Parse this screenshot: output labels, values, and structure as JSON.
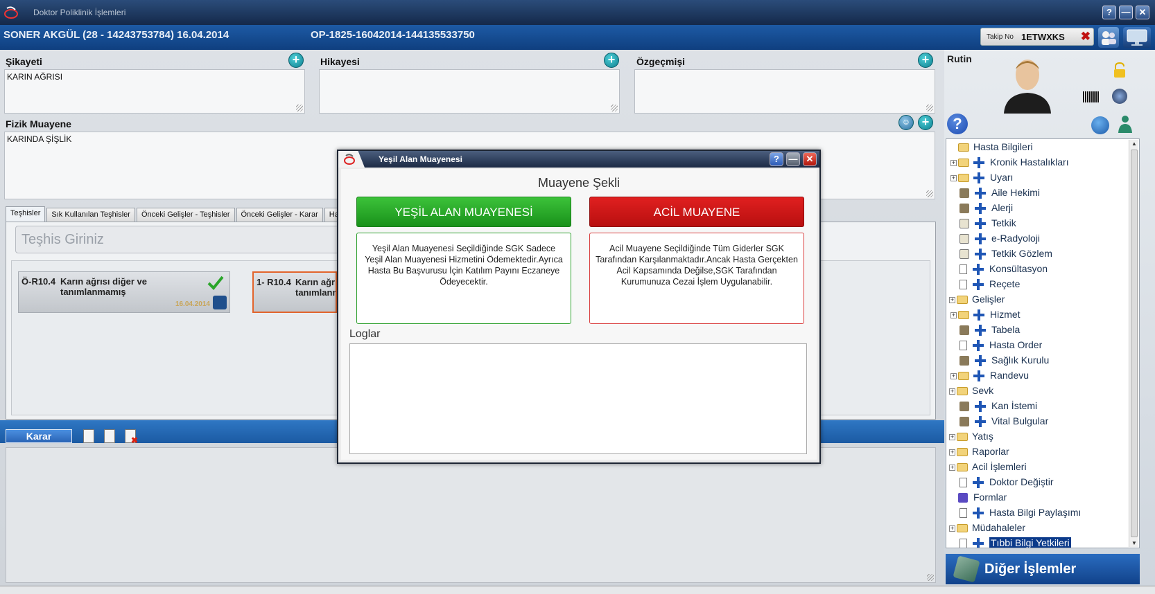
{
  "window": {
    "title": "Doktor Poliklinik İşlemleri",
    "buttons": [
      "?",
      "—",
      "✕"
    ]
  },
  "header": {
    "patient": "SONER AKGÜL (28 - 14243753784) 16.04.2014",
    "protocol": "OP-1825-16042014-144135533750",
    "takip_label": "Takip No",
    "takip_value": "1ETWXKS"
  },
  "fields": {
    "sikayet_label": "Şikayeti",
    "sikayet_value": "KARIN AĞRISI",
    "hikaye_label": "Hikayesi",
    "hikaye_value": "",
    "ozgecmis_label": "Özgeçmişi",
    "ozgecmis_value": "",
    "fizik_label": "Fizik Muayene",
    "fizik_value": "KARINDA ŞİŞLİK"
  },
  "tabs": [
    "Teşhisler",
    "Sık Kullanılan Teşhisler",
    "Önceki Gelişler - Teşhisler",
    "Önceki Gelişler - Karar",
    "Hastay"
  ],
  "diagnosis": {
    "input_placeholder": "Teşhis Giriniz",
    "cards": [
      {
        "code": "Ö-R10.4",
        "name": "Karın ağrısı diğer ve tanımlanmamış",
        "date": "16.04.2014"
      },
      {
        "code": "1- R10.4",
        "name": "Karın ağr tanımlanm",
        "date": ""
      }
    ]
  },
  "karar_label": "Karar",
  "right_panel": {
    "rutin_label": "Rutin",
    "tree": [
      {
        "label": "Hasta Bilgileri",
        "level": 0,
        "kind": "folder-open",
        "exp": ""
      },
      {
        "label": "Kronik Hastalıkları",
        "level": 1,
        "kind": "plus",
        "exp": "+"
      },
      {
        "label": "Uyarı",
        "level": 1,
        "kind": "plus",
        "exp": "+"
      },
      {
        "label": "Aile Hekimi",
        "level": 1,
        "kind": "plus-icon",
        "exp": ""
      },
      {
        "label": "Alerji",
        "level": 1,
        "kind": "plus-icon",
        "exp": ""
      },
      {
        "label": "Tetkik",
        "level": 1,
        "kind": "plus-book",
        "exp": ""
      },
      {
        "label": "e-Radyoloji",
        "level": 1,
        "kind": "plus-book",
        "exp": ""
      },
      {
        "label": "Tetkik Gözlem",
        "level": 1,
        "kind": "plus-book",
        "exp": ""
      },
      {
        "label": "Konsültasyon",
        "level": 1,
        "kind": "plus-page",
        "exp": ""
      },
      {
        "label": "Reçete",
        "level": 1,
        "kind": "plus-page",
        "exp": ""
      },
      {
        "label": "Gelişler",
        "level": 0,
        "kind": "folder",
        "exp": "+"
      },
      {
        "label": "Hizmet",
        "level": 1,
        "kind": "plus",
        "exp": "+"
      },
      {
        "label": "Tabela",
        "level": 1,
        "kind": "plus-icon",
        "exp": ""
      },
      {
        "label": "Hasta Order",
        "level": 1,
        "kind": "plus-page",
        "exp": ""
      },
      {
        "label": "Sağlık Kurulu",
        "level": 1,
        "kind": "plus-icon",
        "exp": ""
      },
      {
        "label": "Randevu",
        "level": 1,
        "kind": "plus",
        "exp": "+"
      },
      {
        "label": "Sevk",
        "level": 0,
        "kind": "folder",
        "exp": "+"
      },
      {
        "label": "Kan İstemi",
        "level": 1,
        "kind": "plus-icon",
        "exp": ""
      },
      {
        "label": "Vital Bulgular",
        "level": 1,
        "kind": "plus-icon",
        "exp": ""
      },
      {
        "label": "Yatış",
        "level": 0,
        "kind": "folder",
        "exp": "+"
      },
      {
        "label": "Raporlar",
        "level": 0,
        "kind": "folder",
        "exp": "+"
      },
      {
        "label": "Acil İşlemleri",
        "level": 0,
        "kind": "folder",
        "exp": "+"
      },
      {
        "label": "Doktor Değiştir",
        "level": 1,
        "kind": "plus-page",
        "exp": ""
      },
      {
        "label": "Formlar",
        "level": 0,
        "kind": "icon",
        "exp": ""
      },
      {
        "label": "Hasta Bilgi Paylaşımı",
        "level": 1,
        "kind": "plus-page",
        "exp": ""
      },
      {
        "label": "Müdahaleler",
        "level": 0,
        "kind": "folder",
        "exp": "+"
      },
      {
        "label": "Tıbbi Bilgi Yetkileri",
        "level": 1,
        "kind": "plus-page",
        "exp": "",
        "selected": true
      }
    ],
    "diger_label": "Diğer İşlemler"
  },
  "modal": {
    "title": "Yeşil Alan Muayenesi",
    "heading": "Muayene Şekli",
    "green_button": "YEŞİL ALAN MUAYENESİ",
    "red_button": "ACİL MUAYENE",
    "green_desc": "Yeşil Alan Muayenesi Seçildiğinde SGK Sadece Yeşil Alan Muayenesi Hizmetini Ödemektedir.Ayrıca Hasta Bu Başvurusu İçin Katılım Payını Eczaneye Ödeyecektir.",
    "red_desc": "Acil Muayene Seçildiğinde Tüm Giderler SGK Tarafından Karşılanmaktadır.Ancak Hasta Gerçekten Acil Kapsamında Değilse,SGK Tarafından Kurumunuza Cezai İşlem Uygulanabilir.",
    "logs_label": "Loglar"
  },
  "colors": {
    "green": "#19911a",
    "red": "#c81414",
    "header_blue": "#1d5aa5",
    "selection": "#0b3a8a"
  }
}
